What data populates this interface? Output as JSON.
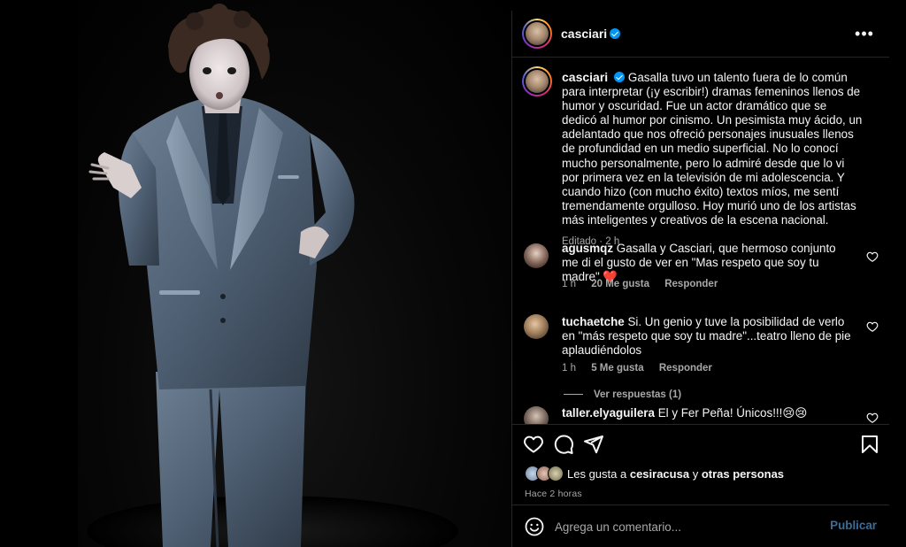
{
  "post": {
    "author": "casciari",
    "caption": "Gasalla tuvo un talento fuera de lo común para interpretar (¡y escribir!) dramas femeninos llenos de humor y oscuridad. Fue un actor dramático que se dedicó al humor por cinismo. Un pesimista muy ácido, un adelantado que nos ofreció personajes inusuales llenos de profundidad en un medio superficial. No lo conocí mucho personalmente, pero lo admiré desde que lo vi por primera vez en la televisión de mi adolescencia. Y cuando hizo (con mucho éxito) textos míos, me sentí tremendamente orgulloso. Hoy murió uno de los artistas más inteligentes y creativos de la escena nacional.",
    "caption_meta": "Editado · 2 h"
  },
  "comments": [
    {
      "user": "agusmqz",
      "text": "Gasalla y Casciari, que hermoso conjunto me di el gusto de ver en \"Mas respeto que soy tu madre\" ❤️",
      "time": "1 h",
      "likes": "20 Me gusta",
      "reply": "Responder"
    },
    {
      "user": "tuchaetche",
      "text": "Si. Un genio y tuve la posibilidad de verlo en \"más respeto que soy tu madre\"...teatro lleno de pie aplaudiéndolos",
      "time": "1 h",
      "likes": "5 Me gusta",
      "reply": "Responder",
      "view_replies": "Ver respuestas (1)"
    },
    {
      "user": "taller.elyaguilera",
      "text": "El y Fer Peña! Únicos!!!😢😢"
    }
  ],
  "likes": {
    "prefix": "Les gusta a",
    "user": "cesiracusa",
    "joiner": "y",
    "others": "otras personas"
  },
  "posted_ago": "Hace 2 horas",
  "comment_box": {
    "placeholder": "Agrega un comentario...",
    "publish_label": "Publicar"
  },
  "icons": {
    "more": "more-options-icon",
    "like": "heart-icon",
    "comment": "comment-icon",
    "share": "share-icon",
    "save": "bookmark-icon",
    "emoji": "emoji-icon"
  },
  "colors": {
    "background": "#000000",
    "text": "#f5f5f5",
    "muted": "#a8a8a8",
    "verified": "#0095f6",
    "publish": "#3a6d99",
    "heart": "#ed4956"
  }
}
